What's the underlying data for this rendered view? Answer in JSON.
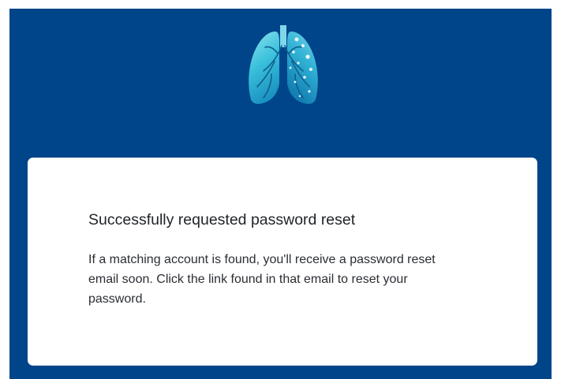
{
  "header": {
    "logo_icon": "lungs-logo-icon",
    "background_color": "#00458a"
  },
  "card": {
    "title": "Successfully requested password reset",
    "message": "If a matching account is found, you'll receive a password reset email soon. Click the link found in that email to reset your password."
  }
}
